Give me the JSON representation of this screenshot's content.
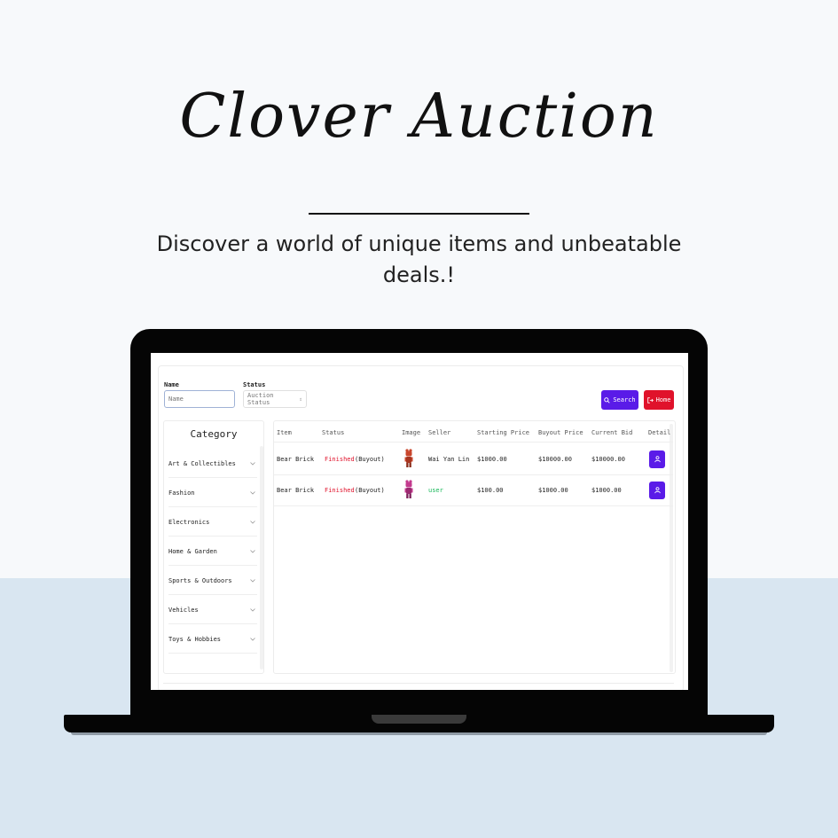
{
  "hero": {
    "title": "Clover Auction",
    "subtitle": "Discover a world of unique items and unbeatable deals.!"
  },
  "filters": {
    "name_label": "Name",
    "name_placeholder": "Name",
    "status_label": "Status",
    "status_value": "Auction Status",
    "status_arrow": "⇕"
  },
  "toolbar": {
    "search_label": "Search",
    "home_label": "Home"
  },
  "category": {
    "title": "Category",
    "items": [
      {
        "label": "Art & Collectibles"
      },
      {
        "label": "Fashion"
      },
      {
        "label": "Electronics"
      },
      {
        "label": "Home & Garden"
      },
      {
        "label": "Sports & Outdoors"
      },
      {
        "label": "Vehicles"
      },
      {
        "label": "Toys & Hobbies"
      }
    ]
  },
  "table": {
    "columns": [
      "Item",
      "Status",
      "Image",
      "Seller",
      "Starting Price",
      "Buyout Price",
      "Current Bid",
      "Detail"
    ],
    "rows": [
      {
        "item": "Bear Brick",
        "status": "Finished",
        "status_note": "(Buyout)",
        "seller": "Wai Yan Lin",
        "starting_price": "$1000.00",
        "buyout_price": "$10000.00",
        "current_bid": "$10000.00",
        "image_color": "#c9462c"
      },
      {
        "item": "Bear Brick",
        "status": "Finished",
        "status_note": "(Buyout)",
        "seller": "user",
        "starting_price": "$100.00",
        "buyout_price": "$1000.00",
        "current_bid": "$1000.00",
        "image_color": "#c33a8e"
      }
    ]
  },
  "colors": {
    "accent": "#5a1be8",
    "danger": "#e0122b",
    "success": "#18b85a"
  },
  "icons": {
    "search": "search-icon",
    "home": "logout-icon",
    "detail": "user-icon",
    "chevron": "chevron-down-icon"
  }
}
